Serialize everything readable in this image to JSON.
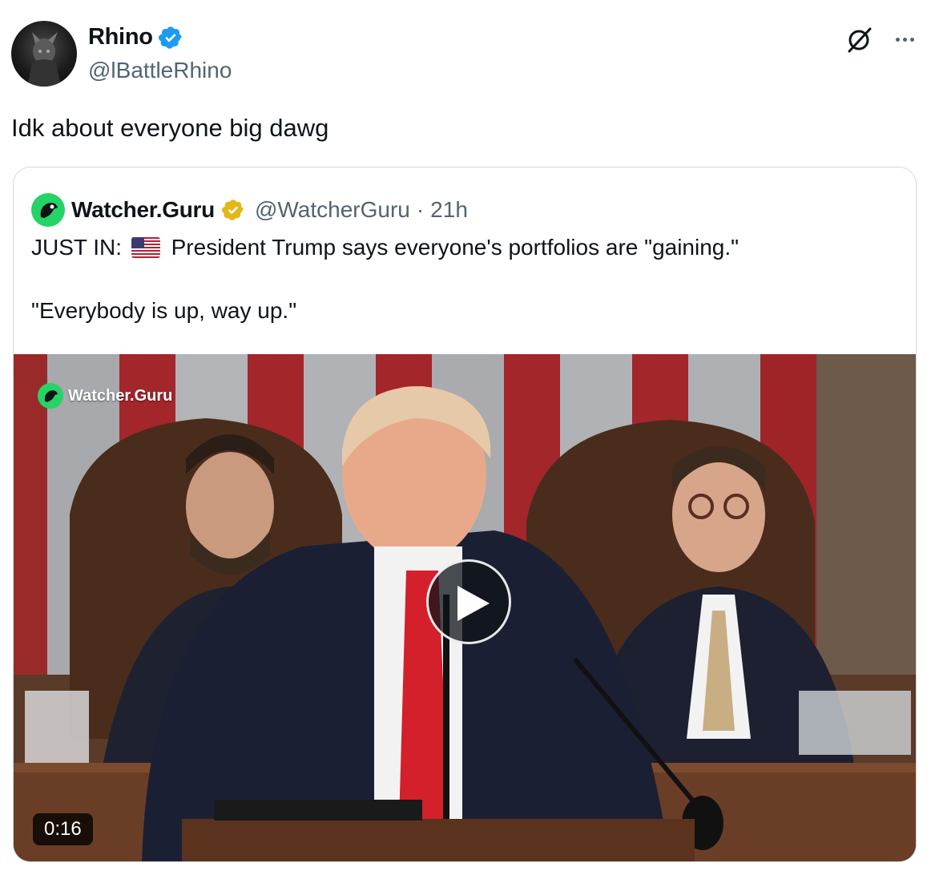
{
  "tweet": {
    "author": {
      "name": "Rhino",
      "handle": "@lBattleRhino",
      "avatar_icon": "avatar-image",
      "verified_color": "#1d9bf0"
    },
    "text": "Idk about everyone big dawg",
    "actions": {
      "grok_icon": "grok-icon",
      "more_icon": "more-options-icon"
    }
  },
  "quoted_tweet": {
    "author": {
      "name": "Watcher.Guru",
      "handle": "@WatcherGuru",
      "separator": "·",
      "time": "21h",
      "verified_color": "#e2b719",
      "avatar_color": "#25d366"
    },
    "text_line1_prefix": "JUST IN:",
    "flag_icon": "us-flag-icon",
    "text_line1_suffix": "President Trump says everyone's portfolios are \"gaining.\"",
    "text_line2": "\"Everybody is up, way up.\"",
    "video": {
      "watermark": "Watcher.Guru",
      "duration": "0:16",
      "play_icon": "play-icon"
    }
  }
}
